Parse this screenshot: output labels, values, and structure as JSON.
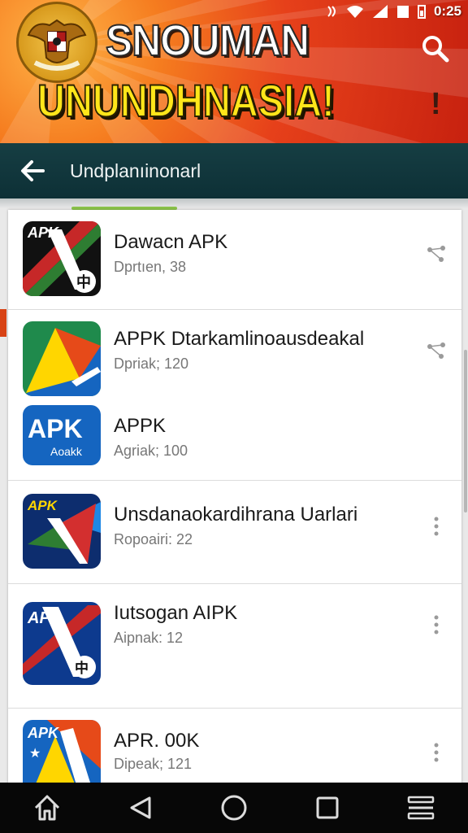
{
  "status_bar": {
    "time": "0:25"
  },
  "banner": {
    "title": "SNOUMAN",
    "subtitle": "UNUNDHNASIA!",
    "colors": {
      "title": "#ffffff",
      "subtitle": "#ffe61a",
      "background": "#e6401a"
    }
  },
  "toolbar": {
    "back_icon": "arrow-left-icon",
    "title": "Undplanıinonarl",
    "background": "#0d3036"
  },
  "apps": [
    {
      "title": "Dawacn APK",
      "subtitle": "Dprtıen, 38",
      "icon": "apk-app-icon",
      "menu_icon": "share-icon"
    },
    {
      "title": "APPK Dtarkamlinoausdeakal",
      "subtitle": "Dpriak; 120",
      "icon": "apk-app-icon",
      "menu_icon": "share-icon"
    },
    {
      "title": "APPK",
      "subtitle": "Agriak; 100",
      "icon": "apk-app-icon",
      "icon_text": "APK",
      "icon_subtext": "Aoakk",
      "menu_icon": ""
    },
    {
      "title": "Unsdanaokardihrana Uarlari",
      "subtitle": "Ropoairi: 22",
      "icon": "apk-app-icon",
      "menu_icon": "more-vert-icon"
    },
    {
      "title": "Iutsogan AIPK",
      "subtitle": "Aipnak: 12",
      "icon": "apk-app-icon",
      "menu_icon": "more-vert-icon"
    },
    {
      "title": "APR. 00K",
      "subtitle": "Dipeak; 121",
      "icon": "apk-app-icon",
      "menu_icon": "more-vert-icon"
    }
  ],
  "icon_labels": {
    "a": "APK",
    "b": "APK",
    "c": "AP",
    "d": "APK"
  },
  "navbar": {
    "items": [
      "home-icon",
      "back-triangle-icon",
      "circle-home-icon",
      "recents-icon",
      "menu-icon"
    ]
  }
}
